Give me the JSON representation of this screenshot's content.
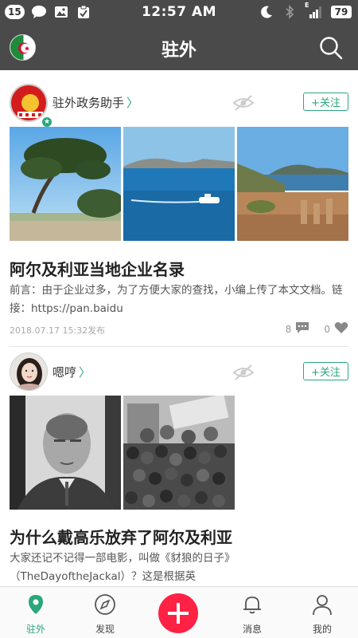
{
  "status_bar": {
    "notification_count": "15",
    "time": "12:57 AM",
    "network": "E",
    "battery": "79",
    "icons": [
      "chat-bubble-icon",
      "image-icon",
      "clipboard-icon",
      "moon-icon",
      "bluetooth-icon",
      "signal-icon",
      "battery-icon"
    ]
  },
  "header": {
    "title": "驻外",
    "left_icon": "algeria-flag-icon",
    "right_icon": "search-icon"
  },
  "posts": [
    {
      "author": "驻外政务助手",
      "follow_label": "+关注",
      "title": "阿尔及利亚当地企业名录",
      "excerpt": "前言：由于企业过多，为了方便大家的查找，小编上传了本文文档。链接：https://pan.baidu",
      "date": "2018.07.17 15:32发布",
      "comments": "8",
      "likes": "0"
    },
    {
      "author": "嗯哼",
      "follow_label": "+关注",
      "title": "为什么戴高乐放弃了阿尔及利亚",
      "excerpt": "大家还记不记得一部电影，叫做《豺狼的日子》（TheDayoftheJackal）？这是根据英",
      "date": "",
      "comments": "",
      "likes": ""
    }
  ],
  "bottom_nav": {
    "items": [
      {
        "label": "驻外",
        "icon": "location-pin-icon",
        "active": true
      },
      {
        "label": "发现",
        "icon": "compass-icon",
        "active": false
      },
      {
        "label": "",
        "icon": "plus-icon",
        "active": false
      },
      {
        "label": "消息",
        "icon": "bell-icon",
        "active": false
      },
      {
        "label": "我的",
        "icon": "person-icon",
        "active": false
      }
    ]
  },
  "colors": {
    "bar_bg": "#4a4a4a",
    "accent_green": "#2aa87a",
    "add_button": "#ff2244"
  }
}
